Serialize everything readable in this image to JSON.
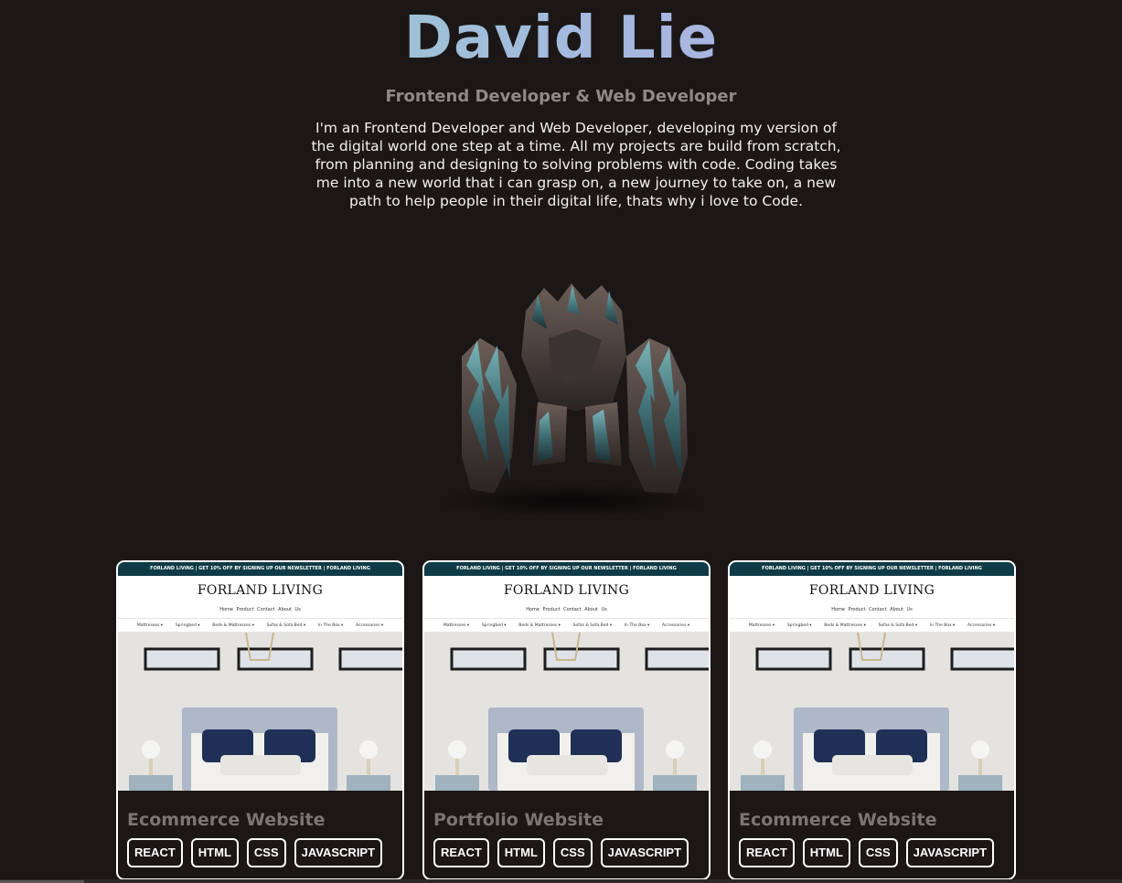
{
  "hero": {
    "name": "David Lie",
    "role": "Frontend Developer & Web Developer",
    "bio": "I'm an Frontend Developer and Web Developer, developing my version of the digital world one step at a time. All my projects are build from scratch, from planning and designing to solving problems with code. Coding takes me into a new world that i can grasp on, a new journey to take on, a new path to help people in their digital life, thats why i love to Code."
  },
  "colors": {
    "background": "#1b1716",
    "name_gradient_start": "#8fd3c4",
    "name_gradient_end": "#b5a8e3",
    "role": "#8d8a88",
    "card_title": "#7a7674",
    "card_border": "#ffffff",
    "thumb_topbar": "#0f3b47"
  },
  "showcase_image": "crystal-golem-3d-model",
  "projects": [
    {
      "title": "Ecommerce Website",
      "tags": [
        "REACT",
        "HTML",
        "CSS",
        "JAVASCRIPT"
      ],
      "thumbnail": {
        "banner": "FORLAND LIVING | GET 10% OFF BY SIGNING UP OUR NEWSLETTER | FORLAND LIVING",
        "brand": "FORLAND LIVING",
        "links": [
          "Home",
          "Product",
          "Contact",
          "About Us"
        ],
        "categories": [
          "Mattresses ▾",
          "Springbed ▾",
          "Beds & Mattresses ▾",
          "Sofas & Sofa Bed ▾",
          "In The Box ▾",
          "Accessories ▾"
        ]
      }
    },
    {
      "title": "Portfolio Website",
      "tags": [
        "REACT",
        "HTML",
        "CSS",
        "JAVASCRIPT"
      ],
      "thumbnail": {
        "banner": "FORLAND LIVING | GET 10% OFF BY SIGNING UP OUR NEWSLETTER | FORLAND LIVING",
        "brand": "FORLAND LIVING",
        "links": [
          "Home",
          "Product",
          "Contact",
          "About Us"
        ],
        "categories": [
          "Mattresses ▾",
          "Springbed ▾",
          "Beds & Mattresses ▾",
          "Sofas & Sofa Bed ▾",
          "In The Box ▾",
          "Accessories ▾"
        ]
      }
    },
    {
      "title": "Ecommerce Website",
      "tags": [
        "REACT",
        "HTML",
        "CSS",
        "JAVASCRIPT"
      ],
      "thumbnail": {
        "banner": "FORLAND LIVING | GET 10% OFF BY SIGNING UP OUR NEWSLETTER | FORLAND LIVING",
        "brand": "FORLAND LIVING",
        "links": [
          "Home",
          "Product",
          "Contact",
          "About Us"
        ],
        "categories": [
          "Mattresses ▾",
          "Springbed ▾",
          "Beds & Mattresses ▾",
          "Sofas & Sofa Bed ▾",
          "In The Box ▾",
          "Accessories ▾"
        ]
      }
    }
  ]
}
